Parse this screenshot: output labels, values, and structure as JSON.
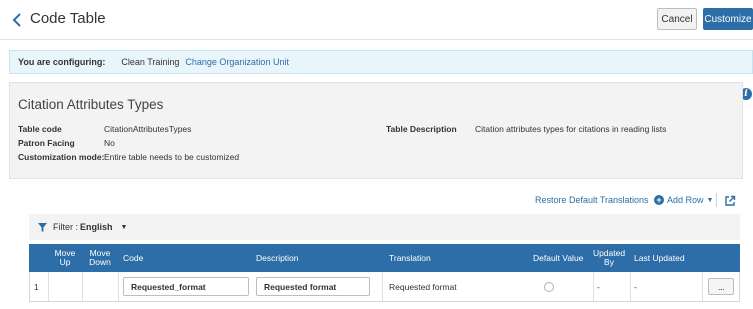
{
  "header": {
    "title": "Code Table",
    "cancel_label": "Cancel",
    "customize_label": "Customize"
  },
  "config": {
    "label": "You are configuring:",
    "org": "Clean Training",
    "change_link": "Change Organization Unit"
  },
  "details": {
    "title": "Citation Attributes Types",
    "table_code_label": "Table code",
    "table_code_value": "CitationAttributesTypes",
    "patron_facing_label": "Patron Facing",
    "patron_facing_value": "No",
    "customization_mode_label": "Customization mode:",
    "customization_mode_value": "Entire table needs to be customized",
    "table_description_label": "Table Description",
    "table_description_value": "Citation attributes types for citations in reading lists"
  },
  "toolbar": {
    "restore_label": "Restore Default Translations",
    "add_row_label": "Add Row"
  },
  "filter": {
    "label": "Filter :",
    "value": "English"
  },
  "table": {
    "headers": {
      "move_up": "Move Up",
      "move_down": "Move Down",
      "code": "Code",
      "description": "Description",
      "translation": "Translation",
      "default_value": "Default Value",
      "updated_by": "Updated By",
      "last_updated": "Last Updated"
    },
    "rows": [
      {
        "index": "1",
        "code": "Requested_format",
        "description": "Requested format",
        "translation": "Requested format",
        "updated_by": "-",
        "last_updated": "-",
        "more_label": "..."
      }
    ]
  },
  "colors": {
    "accent": "#2d6ea8",
    "info_strip_bg": "#e8f5fb",
    "panel_bg": "#f3f3f3"
  },
  "icons": {
    "back": "chevron-left-icon",
    "info": "info-icon",
    "filter": "funnel-icon",
    "add": "plus-circle-icon",
    "export": "external-link-icon"
  }
}
